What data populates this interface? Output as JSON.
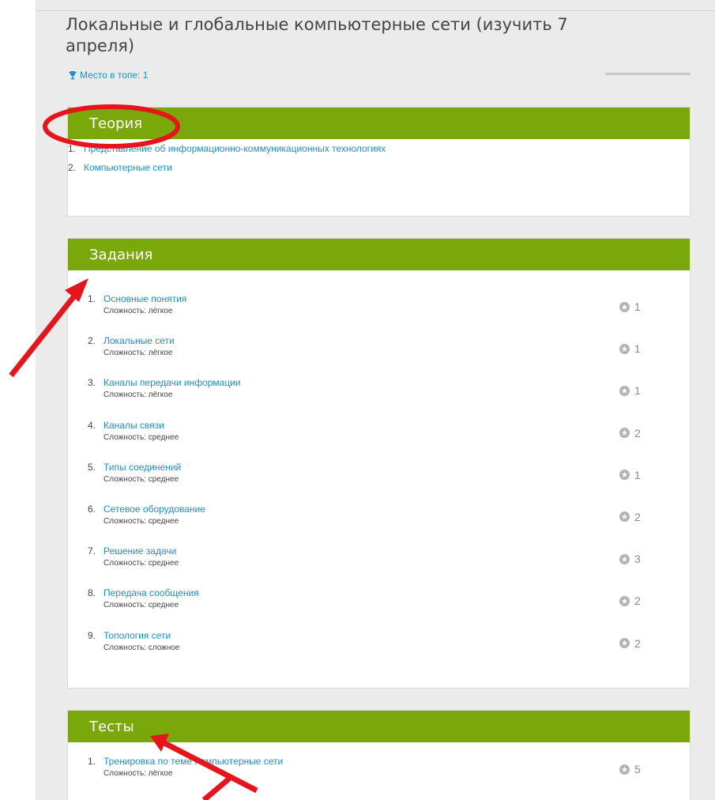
{
  "page": {
    "title": "Локальные и глобальные компьютерные сети (изучить 7 апреля)",
    "rank_text": "Место в топе: 1",
    "icons": {
      "rank": "trophy-icon",
      "points": "star-badge-icon"
    }
  },
  "theory": {
    "header": "Теория",
    "items": [
      {
        "num": "1.",
        "title": "Представление об информационно-коммуникационных технологиях"
      },
      {
        "num": "2.",
        "title": "Компьютерные сети"
      }
    ]
  },
  "tasks": {
    "header": "Задания",
    "difficulty_label": "Сложность:",
    "items": [
      {
        "num": "1.",
        "title": "Основные понятия",
        "difficulty": "лёгкое",
        "points": "1"
      },
      {
        "num": "2.",
        "title": "Локальные сети",
        "difficulty": "лёгкое",
        "points": "1"
      },
      {
        "num": "3.",
        "title": "Каналы передачи информации",
        "difficulty": "лёгкое",
        "points": "1"
      },
      {
        "num": "4.",
        "title": "Каналы связи",
        "difficulty": "среднее",
        "points": "2"
      },
      {
        "num": "5.",
        "title": "Типы соединений",
        "difficulty": "среднее",
        "points": "1"
      },
      {
        "num": "6.",
        "title": "Сетевое оборудование",
        "difficulty": "среднее",
        "points": "2"
      },
      {
        "num": "7.",
        "title": "Решение задачи",
        "difficulty": "среднее",
        "points": "3"
      },
      {
        "num": "8.",
        "title": "Передача сообщения",
        "difficulty": "среднее",
        "points": "2"
      },
      {
        "num": "9.",
        "title": "Топология сети",
        "difficulty": "сложное",
        "points": "2"
      }
    ]
  },
  "tests": {
    "header": "Тесты",
    "items": [
      {
        "num": "1.",
        "title": "Тренировка по теме Компьютерные сети",
        "difficulty": "лёгкое",
        "points": "5"
      }
    ]
  },
  "colors": {
    "accent_green": "#7aa70a",
    "link": "#1b8fd2",
    "annotation_red": "#e8141b"
  }
}
